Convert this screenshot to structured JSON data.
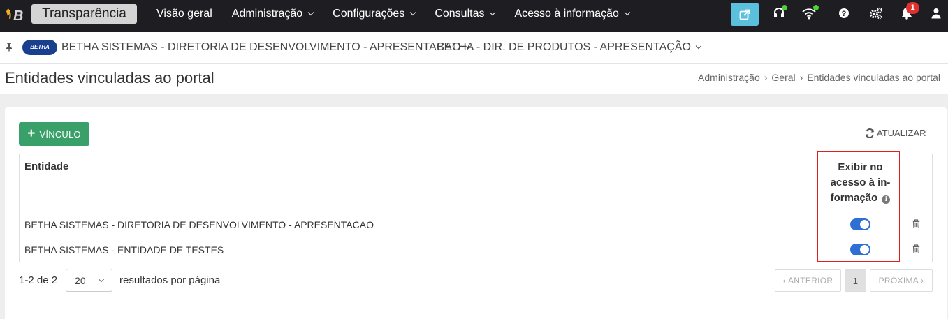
{
  "topnav": {
    "app_title": "Transparência",
    "menu": [
      {
        "label": "Visão geral",
        "dropdown": false
      },
      {
        "label": "Administração",
        "dropdown": true
      },
      {
        "label": "Configurações",
        "dropdown": true
      },
      {
        "label": "Consultas",
        "dropdown": true
      },
      {
        "label": "Acesso à informação",
        "dropdown": true
      }
    ],
    "notification_count": "1",
    "accent_color": "#5bc0de"
  },
  "context": {
    "logo_text": "BETHA",
    "entity": "BETHA SISTEMAS - DIRETORIA DE DESENVOLVIMENTO - APRESENTACAO",
    "database": "BETHA - DIR. DE PRODUTOS - APRESENTAÇÃO"
  },
  "page": {
    "title": "Entidades vinculadas ao portal",
    "breadcrumb": [
      "Administração",
      "Geral",
      "Entidades vinculadas ao portal"
    ]
  },
  "toolbar": {
    "add_label": "VÍNCULO",
    "refresh_label": "ATUALIZAR"
  },
  "table": {
    "headers": {
      "entity": "Entidade",
      "exibir_line1": "Exibir no",
      "exibir_line2": "acesso à in-",
      "exibir_line3": "formação"
    },
    "rows": [
      {
        "entity": "BETHA SISTEMAS - DIRETORIA DE DESENVOLVIMENTO - APRESENTACAO",
        "exibir": true
      },
      {
        "entity": "BETHA SISTEMAS - ENTIDADE DE TESTES",
        "exibir": true
      }
    ]
  },
  "pagination": {
    "summary": "1-2 de 2",
    "per_page": "20",
    "per_page_label": "resultados por página",
    "prev_label": "ANTERIOR",
    "current_page": "1",
    "next_label": "PRÓXIMA"
  }
}
